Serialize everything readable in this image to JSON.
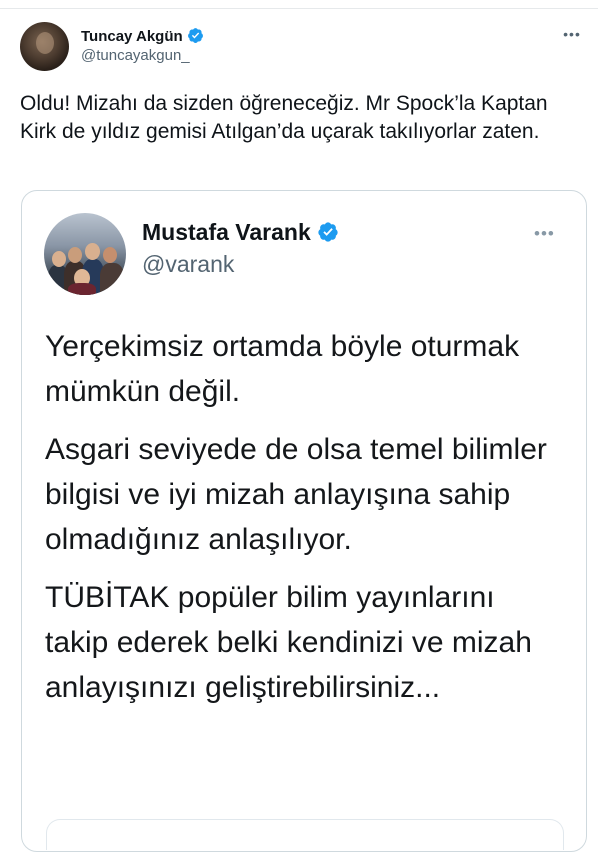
{
  "tweet": {
    "author": {
      "name": "Tuncay Akgün",
      "handle": "@tuncayakgun_",
      "verified": true
    },
    "more_icon": "more-horizontal-icon",
    "text": "Oldu! Mizahı da sizden öğreneceğiz. Mr Spock’la Kaptan Kirk de yıldız gemisi Atılgan’da uçarak takılıyorlar zaten."
  },
  "quoted": {
    "author": {
      "name": "Mustafa Varank",
      "handle": "@varank",
      "verified": true
    },
    "more_icon": "more-horizontal-icon",
    "paragraphs": [
      "Yerçekimsiz ortamda böyle oturmak mümkün değil.",
      "Asgari seviyede de olsa temel bilimler bilgisi ve iyi mizah anlayışına sahip olmadığınız anlaşılıyor.",
      "TÜBİTAK popüler bilim yayınlarını takip ederek belki kendinizi ve mizah anlayışınızı geliştirebilirsiniz..."
    ]
  },
  "colors": {
    "verified_badge": "#1d9bf0",
    "secondary_text": "#536471",
    "border": "#cfd9de"
  }
}
